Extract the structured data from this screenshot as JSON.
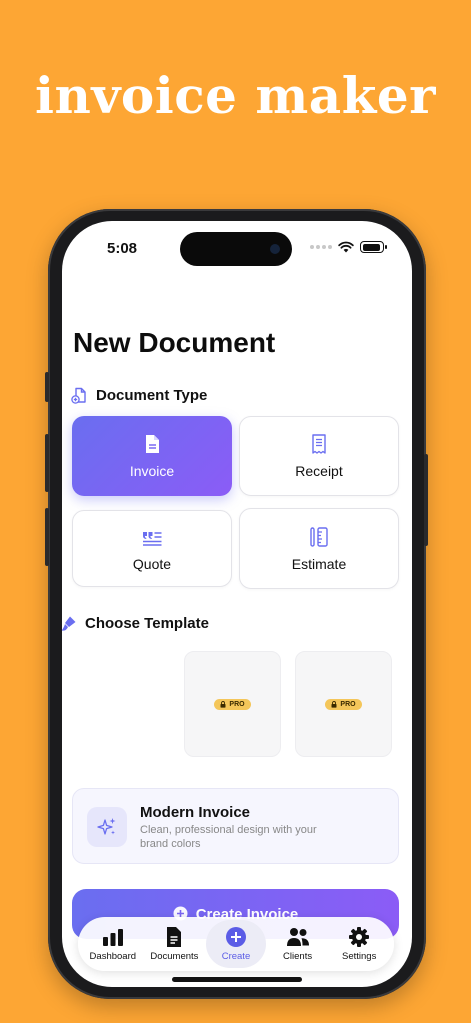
{
  "headline": "invoice maker",
  "status_bar": {
    "time": "5:08"
  },
  "page_title": "New Document",
  "document_type": {
    "heading": "Document Type",
    "types": [
      {
        "label": "Invoice",
        "icon": "document-icon",
        "selected": true
      },
      {
        "label": "Receipt",
        "icon": "receipt-icon",
        "selected": false
      },
      {
        "label": "Quote",
        "icon": "quote-icon",
        "selected": false
      },
      {
        "label": "Estimate",
        "icon": "ruler-icon",
        "selected": false
      }
    ]
  },
  "template": {
    "heading": "Choose Template",
    "pro_badge": "PRO",
    "selected": {
      "name": "Modern Invoice",
      "description": "Clean, professional design with your brand colors"
    }
  },
  "create_button": {
    "label": "Create Invoice"
  },
  "tab_bar": {
    "tabs": [
      {
        "label": "Dashboard",
        "icon": "chart-bars-icon"
      },
      {
        "label": "Documents",
        "icon": "documents-icon"
      },
      {
        "label": "Create",
        "icon": "plus-circle-icon",
        "selected": true
      },
      {
        "label": "Clients",
        "icon": "people-icon"
      },
      {
        "label": "Settings",
        "icon": "gear-icon"
      }
    ]
  },
  "colors": {
    "background": "#FDA634",
    "accent": "#6A6EF0",
    "accent_end": "#8B5CF6",
    "pro_badge": "#F4C65A"
  }
}
